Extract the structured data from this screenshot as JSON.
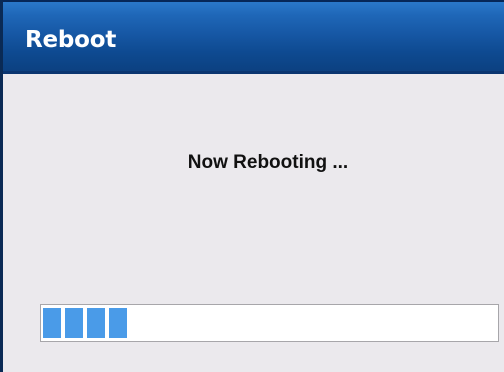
{
  "window": {
    "title": "Reboot"
  },
  "content": {
    "message": "Now Rebooting ..."
  },
  "progress": {
    "fraction": 0.2,
    "color": "#4a9be8"
  }
}
